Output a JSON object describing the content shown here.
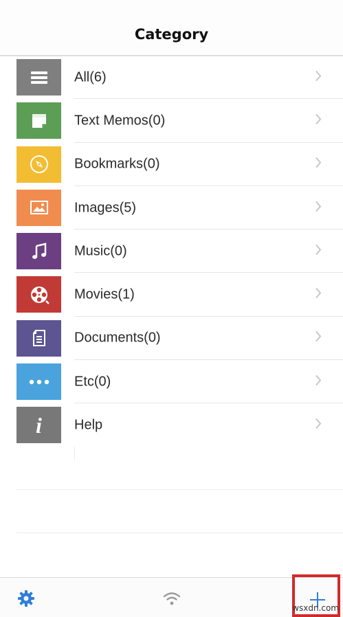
{
  "header": {
    "title": "Category"
  },
  "categories": [
    {
      "label": "All(6)",
      "icon": "list-icon",
      "color": "#7f7f7f"
    },
    {
      "label": "Text Memos(0)",
      "icon": "memo-icon",
      "color": "#5c9e55"
    },
    {
      "label": "Bookmarks(0)",
      "icon": "compass-icon",
      "color": "#f2bd32"
    },
    {
      "label": "Images(5)",
      "icon": "image-icon",
      "color": "#f18c4f"
    },
    {
      "label": "Music(0)",
      "icon": "music-note-icon",
      "color": "#6b3f82"
    },
    {
      "label": "Movies(1)",
      "icon": "film-reel-icon",
      "color": "#c23a35"
    },
    {
      "label": "Documents(0)",
      "icon": "document-icon",
      "color": "#5c5592"
    },
    {
      "label": "Etc(0)",
      "icon": "more-dots-icon",
      "color": "#4aa3dc"
    },
    {
      "label": "Help",
      "icon": "info-icon",
      "color": "#787878"
    }
  ],
  "tab_bar": {
    "settings_icon": "gear-icon",
    "wifi_icon": "wifi-icon",
    "add_icon": "plus-icon",
    "accent": "#2f7ed8",
    "highlight_color": "#d22a2a"
  },
  "watermark": "wsxdn.com"
}
